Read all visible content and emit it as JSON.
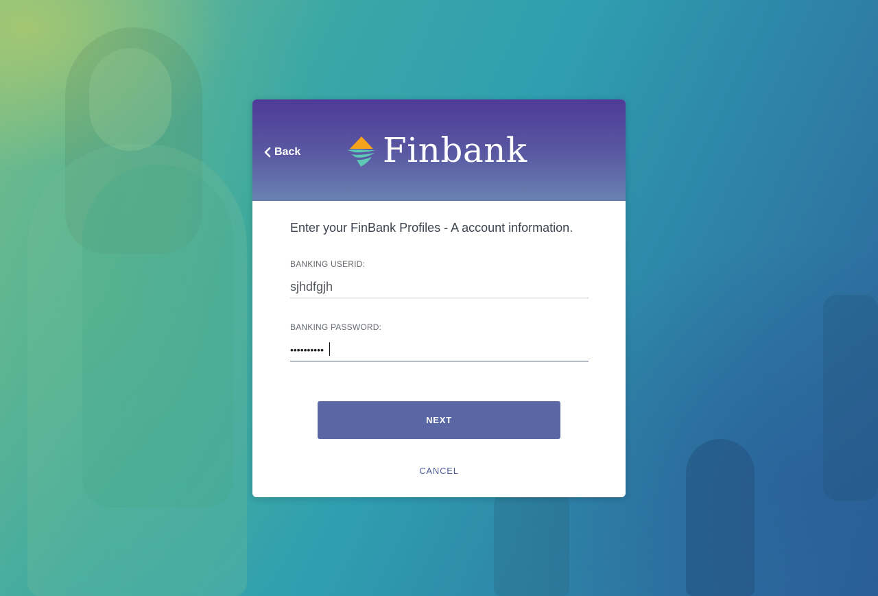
{
  "header": {
    "back_label": "Back",
    "brand_name": "Finbank",
    "colors": {
      "gradient_top": "#4e3a98",
      "gradient_bottom": "#6a82b2",
      "logo_orange": "#f5a31a",
      "logo_teal": "#5ec9b5"
    }
  },
  "form": {
    "intro": "Enter your FinBank Profiles - A account information.",
    "userid": {
      "label": "BANKING USERID:",
      "value": "sjhdfgjh"
    },
    "password": {
      "label": "BANKING PASSWORD:",
      "value": "••••••••••"
    },
    "next_label": "NEXT",
    "cancel_label": "CANCEL",
    "colors": {
      "button": "#5a67a5",
      "link": "#4d5c9a"
    }
  },
  "icons": {
    "back": "chevron-left-icon",
    "logo": "finbank-logo-icon"
  }
}
